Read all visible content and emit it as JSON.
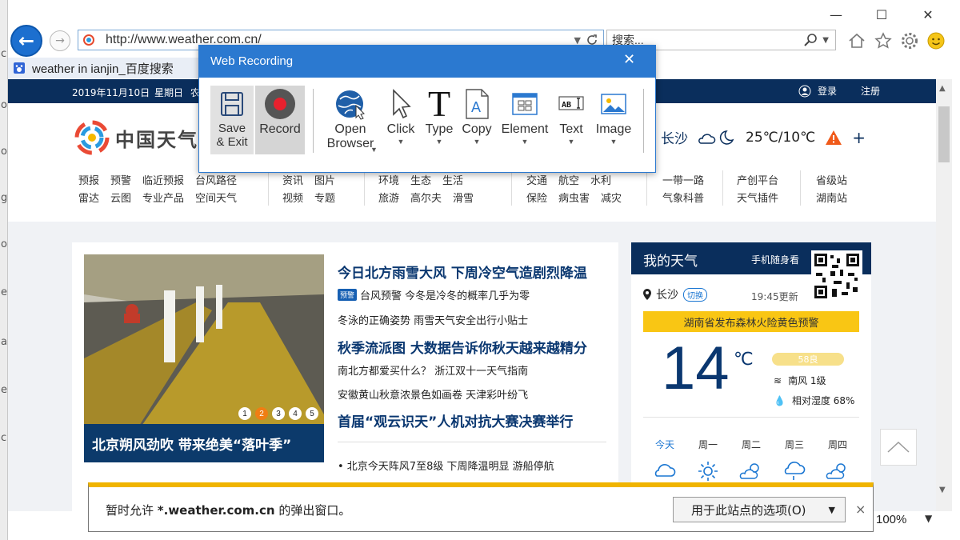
{
  "edge": {
    "letters": [
      "c",
      "o",
      "o",
      "g",
      "o",
      "e",
      "a",
      "e",
      "c"
    ]
  },
  "browser": {
    "url": "http://www.weather.com.cn/",
    "search_placeholder": "搜索...",
    "tab_title": "weather in ianjin_百度搜索",
    "zoom": "100%"
  },
  "dialog": {
    "title": "Web Recording",
    "buttons": {
      "save_exit": "Save\n& Exit",
      "record": "Record",
      "open_browser": "Open\nBrowser",
      "click": "Click",
      "type": "Type",
      "copy": "Copy",
      "element": "Element",
      "text": "Text",
      "image": "Image"
    }
  },
  "site": {
    "topbar": {
      "date": "2019年11月10日",
      "weekday": "星期日",
      "lunar": "农",
      "login": "登录",
      "register": "注册"
    },
    "brand": "中国天气",
    "location_city": "长沙",
    "location_temp": "25℃/10℃",
    "nav": [
      {
        "row1": [
          "预报",
          "预警",
          "临近预报",
          "台风路径"
        ],
        "row2": [
          "雷达",
          "云图",
          "专业产品",
          "空间天气"
        ]
      },
      {
        "row1": [
          "资讯",
          "图片"
        ],
        "row2": [
          "视频",
          "专题"
        ]
      },
      {
        "row1": [
          "环境",
          "生态",
          "生活"
        ],
        "row2": [
          "旅游",
          "高尔夫",
          "滑雪"
        ]
      },
      {
        "row1": [
          "交通",
          "航空",
          "水利"
        ],
        "row2": [
          "保险",
          "病虫害",
          "减灾"
        ]
      },
      {
        "row1": [
          "一带一路"
        ],
        "row2": [
          "气象科普"
        ]
      },
      {
        "row1": [
          "产创平台"
        ],
        "row2": [
          "天气插件"
        ]
      },
      {
        "row1": [
          "省级站"
        ],
        "row2": [
          "湖南站"
        ]
      }
    ],
    "photo_caption": "北京朔风劲吹 带来绝美“落叶季”",
    "slider_dots": [
      "1",
      "2",
      "3",
      "4",
      "5"
    ],
    "headlines": [
      "今日北方雨雪大风 下周冷空气造剧烈降温",
      "秋季流派图 大数据告诉你秋天越来越精分",
      "首届“观云识天”人机对抗大赛决赛举行"
    ],
    "badge": "预警",
    "items": [
      "台风预警 今冬是冷冬的概率几乎为零",
      "冬泳的正确姿势 雨雪天气安全出行小贴士",
      "南北方都爱买什么？ 浙江双十一天气指南",
      "安徽黄山秋意浓景色如画卷 天津彩叶纷飞",
      "• 北京今天阵风7至8级 下周降温明显  游船停航"
    ],
    "my_weather": {
      "title": "我的天气",
      "mobile": "手机随身看",
      "city": "长沙",
      "switch": "切换",
      "updated": "19:45更新",
      "alert": "湖南省发布森林火险黄色预警",
      "temp": "14",
      "unit": "℃",
      "aqi": "58良",
      "wind": "南风  1级",
      "humidity": "相对湿度  68%",
      "days": [
        "今天",
        "周一",
        "周二",
        "周三",
        "周四"
      ]
    }
  },
  "notification": {
    "prefix": "暂时允许 ",
    "site": "*.weather.com.cn",
    "suffix": " 的弹出窗口。",
    "options": "用于此站点的选项(O)"
  },
  "colors": {
    "accent": "#2b79d0",
    "site_navy": "#0a2e5c",
    "alert_yellow": "#f9c614",
    "notif_bar": "#f0b400"
  }
}
